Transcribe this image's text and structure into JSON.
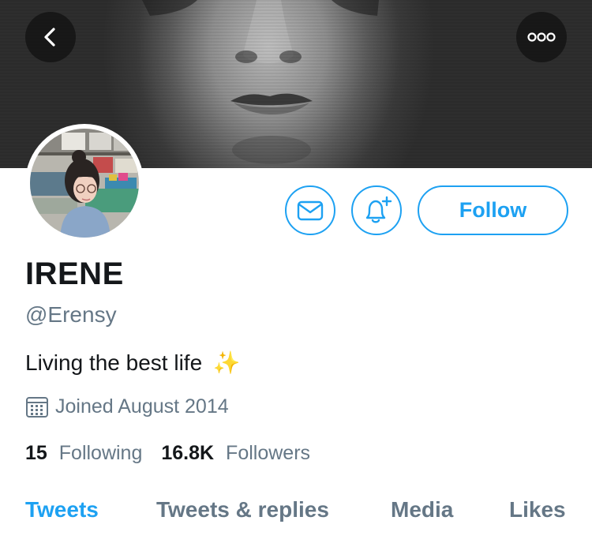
{
  "profile": {
    "name": "IRENE",
    "handle": "@Erensy",
    "bio": "Living the best life",
    "bio_emoji": "✨",
    "joined": "Joined August 2014",
    "following_count": "15",
    "following_label": "Following",
    "followers_count": "16.8K",
    "followers_label": "Followers"
  },
  "actions": {
    "follow_label": "Follow",
    "message_icon": "envelope-icon",
    "notify_icon": "bell-plus-icon"
  },
  "tabs": [
    {
      "label": "Tweets",
      "active": true
    },
    {
      "label": "Tweets & replies",
      "active": false
    },
    {
      "label": "Media",
      "active": false
    },
    {
      "label": "Likes",
      "active": false
    }
  ],
  "colors": {
    "accent": "#1da1f2",
    "secondary_text": "#657786",
    "primary_text": "#14171a"
  }
}
